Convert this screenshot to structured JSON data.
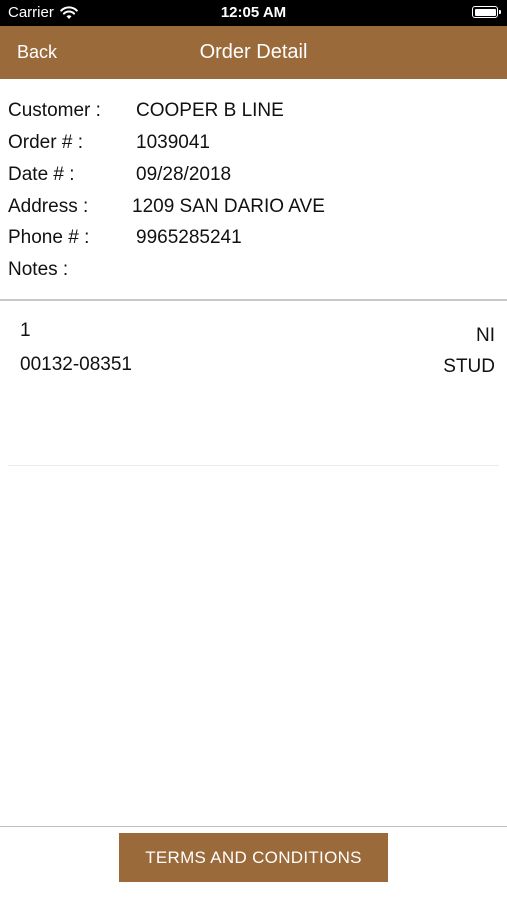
{
  "status_bar": {
    "carrier": "Carrier",
    "time": "12:05 AM"
  },
  "nav": {
    "back_label": "Back",
    "title": "Order Detail"
  },
  "order": {
    "customer_label": "Customer :",
    "customer_value": "COOPER B LINE",
    "order_label": "Order # :",
    "order_value": "1039041",
    "date_label": "Date # :",
    "date_value": "09/28/2018",
    "address_label": "Address :",
    "address_value": "1209 SAN DARIO AVE",
    "phone_label": "Phone # :",
    "phone_value": "9965285241",
    "notes_label": "Notes :",
    "notes_value": ""
  },
  "line_items": [
    {
      "quantity": "1",
      "part_number": "00132-08351",
      "description_line1": "NI",
      "description_line2": "STUD"
    }
  ],
  "footer": {
    "terms_label": "TERMS AND CONDITIONS"
  },
  "colors": {
    "brand": "#9b6a3a",
    "status_bar": "#000000",
    "text": "#111111"
  }
}
